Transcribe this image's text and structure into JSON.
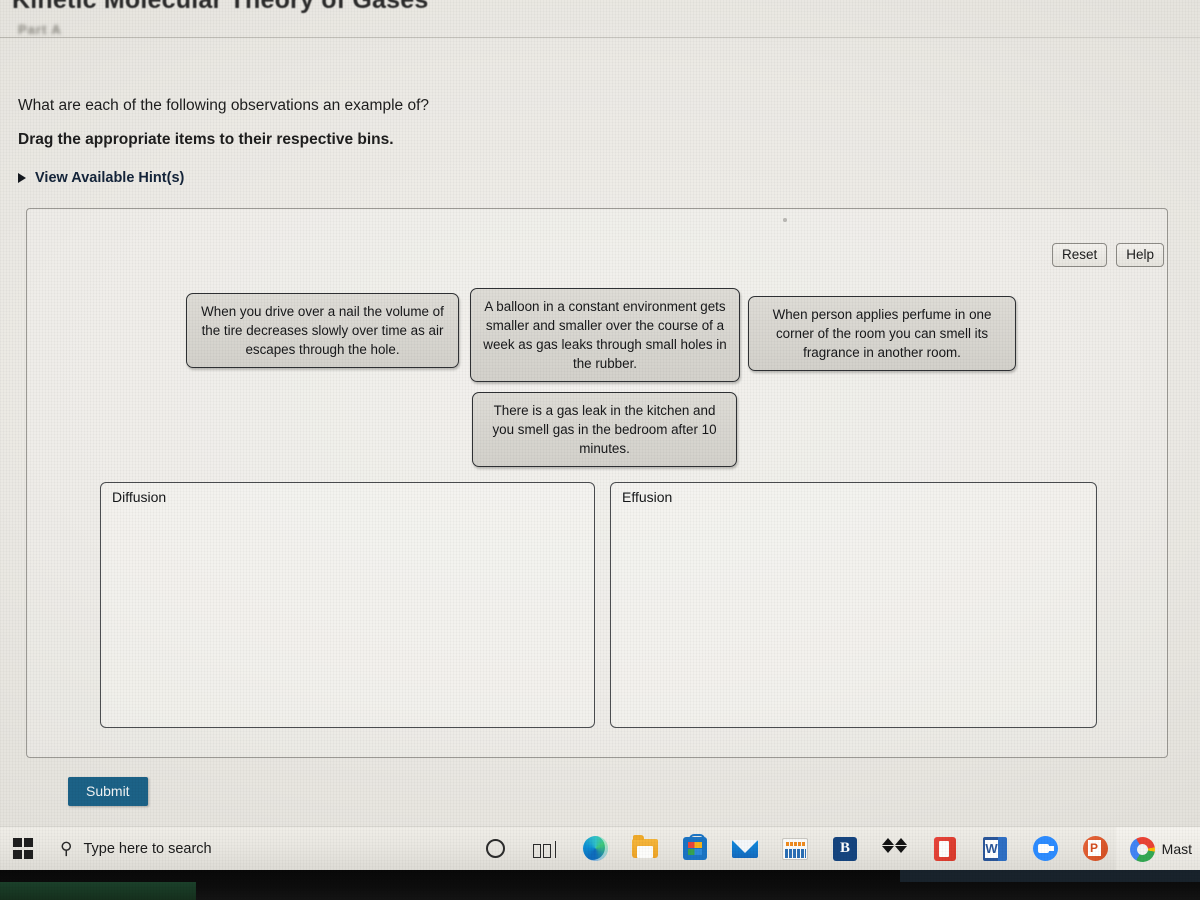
{
  "page": {
    "heading": "Kinetic Molecular Theory of Gases",
    "part_label": "Part A"
  },
  "question": {
    "prompt": "What are each of the following observations an example of?",
    "instruction": "Drag the appropriate items to their respective bins.",
    "hints_label": "View Available Hint(s)",
    "hints_icon": "triangle-right-icon"
  },
  "toolbar": {
    "reset_label": "Reset",
    "help_label": "Help"
  },
  "drag_items": [
    {
      "id": "item-tire-nail",
      "text": "When you drive over a nail the volume of the tire decreases slowly over time as air escapes through the hole."
    },
    {
      "id": "item-balloon",
      "text": "A balloon in a constant environment gets smaller and smaller over the course of a week as gas leaks through small holes in the rubber."
    },
    {
      "id": "item-perfume",
      "text": "When person applies perfume in one corner of the room you can smell its fragrance in another room."
    },
    {
      "id": "item-gas-leak",
      "text": "There is a gas leak in the kitchen and you smell gas in the bedroom after 10 minutes."
    }
  ],
  "bins": [
    {
      "id": "bin-diffusion",
      "label": "Diffusion",
      "items": []
    },
    {
      "id": "bin-effusion",
      "label": "Effusion",
      "items": []
    }
  ],
  "actions": {
    "submit_label": "Submit",
    "submit_color": "#1c6287"
  },
  "taskbar": {
    "start_icon": "windows-logo-icon",
    "search_placeholder": "Type here to search",
    "search_icon": "search-icon",
    "pinned": [
      {
        "name": "cortana-icon",
        "label": "Cortana"
      },
      {
        "name": "task-view-icon",
        "label": "Task View"
      },
      {
        "name": "edge-icon",
        "label": "Microsoft Edge"
      },
      {
        "name": "file-explorer-icon",
        "label": "File Explorer"
      },
      {
        "name": "microsoft-store-icon",
        "label": "Microsoft Store"
      },
      {
        "name": "mail-icon",
        "label": "Mail"
      },
      {
        "name": "amazon-icon",
        "label": "Amazon"
      },
      {
        "name": "blackboard-icon",
        "label": "B"
      },
      {
        "name": "dropbox-icon",
        "label": "Dropbox"
      },
      {
        "name": "office-icon",
        "label": "Office"
      },
      {
        "name": "word-icon",
        "label": "Word"
      },
      {
        "name": "zoom-icon",
        "label": "Zoom"
      },
      {
        "name": "powerpoint-icon",
        "label": "PowerPoint"
      }
    ],
    "active_window": {
      "icon": "chrome-icon",
      "title": "Mast"
    }
  }
}
